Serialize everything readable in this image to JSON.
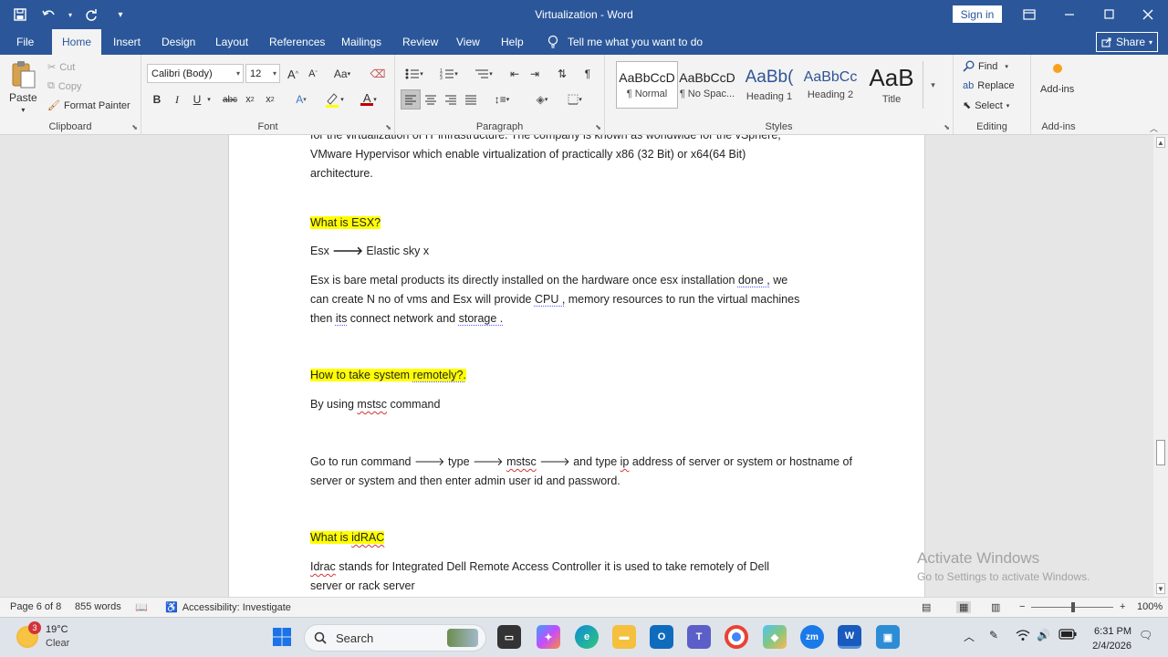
{
  "titlebar": {
    "doc_title": "Virtualization  -  Word",
    "signin": "Sign in",
    "qat_icons": [
      "save-icon",
      "undo-icon",
      "redo-icon",
      "customize-icon"
    ],
    "bg_color": "#2b579a"
  },
  "tabs": [
    "File",
    "Home",
    "Insert",
    "Design",
    "Layout",
    "References",
    "Mailings",
    "Review",
    "View",
    "Help"
  ],
  "active_tab": "Home",
  "tellme": "Tell me what you want to do",
  "share": "Share",
  "clipboard": {
    "paste": "Paste",
    "cut": "Cut",
    "copy": "Copy",
    "format_painter": "Format Painter",
    "label": "Clipboard"
  },
  "font": {
    "name": "Calibri (Body)",
    "size": "12",
    "label": "Font",
    "bold": "B",
    "italic": "I",
    "underline": "U",
    "strike": "abc",
    "grow": "A",
    "shrink": "A",
    "case": "Aa",
    "font_color": "A",
    "effects": "A"
  },
  "paragraph": {
    "label": "Paragraph"
  },
  "styles": {
    "label": "Styles",
    "items": [
      {
        "sample": "AaBbCcD",
        "name": "¶ Normal"
      },
      {
        "sample": "AaBbCcD",
        "name": "¶ No Spac..."
      },
      {
        "sample": "AaBb(",
        "name": "Heading 1"
      },
      {
        "sample": "AaBbCc",
        "name": "Heading 2"
      },
      {
        "sample": "AaB",
        "name": "Title"
      }
    ]
  },
  "editing": {
    "find": "Find",
    "replace": "Replace",
    "select": "Select",
    "label": "Editing"
  },
  "addins": {
    "button": "Add-ins",
    "label": "Add-ins"
  },
  "document": {
    "p1_line1": "for the virtualization of IT infrastructure. The company is known as worldwide for the vSphere,",
    "p1_line2": "VMware Hypervisor which enable virtualization of practically x86 (32 Bit) or x64(64 Bit)",
    "p1_line3": "architecture.",
    "h_esx": "What is ESX?",
    "esx_def_a": "Esx",
    "esx_def_b": "Elastic sky x",
    "esx_p_1": "Esx is bare metal products its directly installed on the hardware once esx installation ",
    "esx_p_done": "done ,",
    "esx_p_2": " we",
    "esx_p_3": "can create N no of vms and Esx will provide ",
    "esx_p_cpu": "CPU ,",
    "esx_p_4": " memory resources to run the virtual machines",
    "esx_p_5": "then ",
    "esx_p_its": "its",
    "esx_p_6": " connect network and ",
    "esx_p_storage": "storage .",
    "h_remote_a": "How to take system ",
    "h_remote_b": "remotely?.",
    "mstsc_a": "By using ",
    "mstsc_b": "mstsc",
    "mstsc_c": " command",
    "run_a": "Go to run command ",
    "run_b": " type ",
    "run_c": "mstsc",
    "run_d": " and type ",
    "run_e": "ip",
    "run_f": " address of server or system or hostname of",
    "run_g": "server or system and then enter admin user id and password.",
    "h_idrac_a": "What is ",
    "h_idrac_b": "idRAC",
    "idrac_a": "Idrac",
    "idrac_b": " stands for Integrated Dell Remote Access Controller it is used to take remotely of Dell",
    "idrac_c": "server or rack server",
    "highlight_color": "#ffff00"
  },
  "watermark": {
    "line1": "Activate Windows",
    "line2": "Go to Settings to activate Windows."
  },
  "status": {
    "page": "Page 6 of 8",
    "words": "855 words",
    "accessibility": "Accessibility: Investigate",
    "zoom": "100%"
  },
  "taskbar": {
    "temp": "19°C",
    "condition": "Clear",
    "weather_badge": "3",
    "search": "Search",
    "time": "6:31 PM",
    "date": "2/4/2026"
  }
}
